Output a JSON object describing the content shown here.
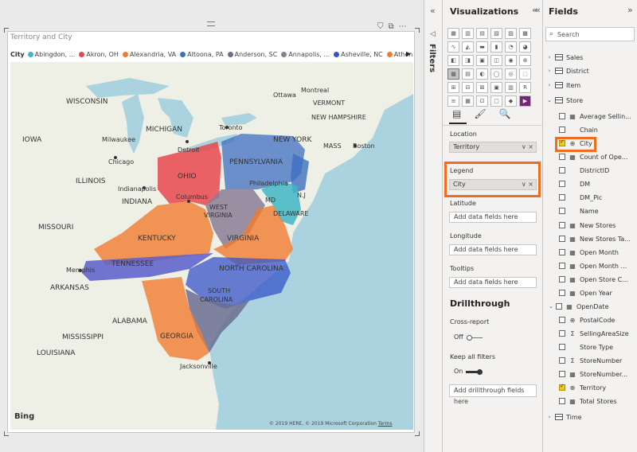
{
  "visual": {
    "title": "Territory and City",
    "legend_title": "City",
    "legend_items": [
      {
        "label": "Abingdon, ...",
        "color": "#41b6c4"
      },
      {
        "label": "Akron, OH",
        "color": "#e8474e"
      },
      {
        "label": "Alexandria, VA",
        "color": "#f07c2f"
      },
      {
        "label": "Altoona, PA",
        "color": "#3d6fc0"
      },
      {
        "label": "Anderson, SC",
        "color": "#6a6e91"
      },
      {
        "label": "Annapolis, ...",
        "color": "#8a7d95"
      },
      {
        "label": "Asheville, NC",
        "color": "#3654c8"
      },
      {
        "label": "Athens, GA",
        "color": "#f07c2f"
      }
    ],
    "legend_more": "▶",
    "toolbar_icons": [
      "filter-icon",
      "focus-mode-icon",
      "more-options-icon"
    ],
    "toolbar_glyphs": [
      "⛉",
      "⧉",
      "⋯"
    ]
  },
  "map": {
    "labels": {
      "ottawa": "Ottawa",
      "montreal": "Montreal",
      "vermont": "VERMONT",
      "wisconsin": "WISCONSIN",
      "michigan": "MICHIGAN",
      "toronto": "Toronto",
      "new_hampshire": "NEW HAMPSHIRE",
      "iowa": "IOWA",
      "milwaukee": "Milwaukee",
      "new_york": "NEW YORK",
      "massachusetts": "MASS",
      "boston": "Boston",
      "detroit": "Detroit",
      "chicago": "Chicago",
      "illinois": "ILLINOIS",
      "ohio": "OHIO",
      "pennsylvania": "PENNSYLVANIA",
      "indianapolis": "Indianapolis",
      "philadelphia": "Philadelphia",
      "indiana": "INDIANA",
      "columbus": "Columbus",
      "md": "MD",
      "nj": "N.J",
      "west_virginia_1": "WEST",
      "west_virginia_2": "VIRGINIA",
      "delaware": "DELAWARE",
      "missouri": "MISSOURI",
      "kentucky": "KENTUCKY",
      "virginia": "VIRGINIA",
      "tennessee": "TENNESSEE",
      "memphis": "Memphis",
      "north_carolina": "NORTH CAROLINA",
      "arkansas": "ARKANSAS",
      "south_carolina_1": "SOUTH",
      "south_carolina_2": "CAROLINA",
      "alabama": "ALABAMA",
      "mississippi": "MISSISSIPPI",
      "georgia": "GEORGIA",
      "louisiana": "LOUISIANA",
      "jacksonville": "Jacksonville"
    },
    "bing": "Bing",
    "copyright": "© 2019 HERE, © 2019 Microsoft Corporation",
    "terms": "Terms"
  },
  "filters": {
    "label": "Filters",
    "collapse_glyph": "«",
    "arrow_glyph": "◁"
  },
  "visualizations": {
    "title": "Visualizations",
    "nav_left": "«",
    "nav_right": "«",
    "tabs": [
      "fields-tab",
      "format-tab",
      "analytics-tab"
    ],
    "tab_glyphs": [
      "▤",
      "🖌",
      "🔍"
    ],
    "wells": {
      "location_label": "Location",
      "location_value": "Territory",
      "legend_label": "Legend",
      "legend_value": "City",
      "latitude_label": "Latitude",
      "latitude_placeholder": "Add data fields here",
      "longitude_label": "Longitude",
      "longitude_placeholder": "Add data fields here",
      "tooltips_label": "Tooltips",
      "tooltips_placeholder": "Add data fields here",
      "controls": "∨ ×"
    },
    "drillthrough": {
      "title": "Drillthrough",
      "cross_report_label": "Cross-report",
      "cross_report_state": "Off",
      "keep_filters_label": "Keep all filters",
      "keep_filters_state": "On",
      "add_fields": "Add drillthrough fields here"
    }
  },
  "fields": {
    "title": "Fields",
    "nav": "»",
    "search_placeholder": "Search",
    "items": [
      {
        "label": "Sales",
        "type": "table",
        "level": 0,
        "expanded": false
      },
      {
        "label": "District",
        "type": "table",
        "level": 0,
        "expanded": false
      },
      {
        "label": "Item",
        "type": "table",
        "level": 0,
        "expanded": false
      },
      {
        "label": "Store",
        "type": "table",
        "level": 0,
        "expanded": true
      },
      {
        "label": "Average Sellin...",
        "type": "measure",
        "level": 1,
        "checked": false
      },
      {
        "label": "Chain",
        "type": "text",
        "level": 1,
        "checked": false
      },
      {
        "label": "City",
        "type": "geo",
        "level": 1,
        "checked": true
      },
      {
        "label": "Count of Ope...",
        "type": "measure",
        "level": 1,
        "checked": false
      },
      {
        "label": "DistrictID",
        "type": "text",
        "level": 1,
        "checked": false
      },
      {
        "label": "DM",
        "type": "text",
        "level": 1,
        "checked": false
      },
      {
        "label": "DM_Pic",
        "type": "text",
        "level": 1,
        "checked": false
      },
      {
        "label": "Name",
        "type": "text",
        "level": 1,
        "checked": false
      },
      {
        "label": "New Stores",
        "type": "measure",
        "level": 1,
        "checked": false
      },
      {
        "label": "New Stores Ta...",
        "type": "measure",
        "level": 1,
        "checked": false
      },
      {
        "label": "Open Month",
        "type": "measure",
        "level": 1,
        "checked": false
      },
      {
        "label": "Open Month ...",
        "type": "measure",
        "level": 1,
        "checked": false
      },
      {
        "label": "Open Store C...",
        "type": "measure",
        "level": 1,
        "checked": false
      },
      {
        "label": "Open Year",
        "type": "measure",
        "level": 1,
        "checked": false
      },
      {
        "label": "OpenDate",
        "type": "date",
        "level": 1,
        "checked": false
      },
      {
        "label": "PostalCode",
        "type": "geo",
        "level": 1,
        "checked": false
      },
      {
        "label": "SellingAreaSize",
        "type": "sigma",
        "level": 1,
        "checked": false
      },
      {
        "label": "Store Type",
        "type": "text",
        "level": 1,
        "checked": false
      },
      {
        "label": "StoreNumber",
        "type": "sigma",
        "level": 1,
        "checked": false
      },
      {
        "label": "StoreNumber...",
        "type": "measure",
        "level": 1,
        "checked": false
      },
      {
        "label": "Territory",
        "type": "geo",
        "level": 1,
        "checked": true
      },
      {
        "label": "Total Stores",
        "type": "measure",
        "level": 1,
        "checked": false
      },
      {
        "label": "Time",
        "type": "table",
        "level": 0,
        "expanded": false
      }
    ]
  }
}
